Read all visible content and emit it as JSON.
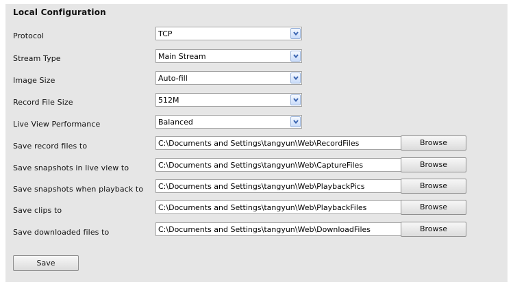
{
  "page": {
    "title": "Local Configuration"
  },
  "selects": [
    {
      "label": "Protocol",
      "value": "TCP"
    },
    {
      "label": "Stream Type",
      "value": "Main Stream"
    },
    {
      "label": "Image Size",
      "value": "Auto-fill"
    },
    {
      "label": "Record File Size",
      "value": "512M"
    },
    {
      "label": "Live View Performance",
      "value": "Balanced"
    }
  ],
  "paths": [
    {
      "label": "Save record files to",
      "value": "C:\\Documents and Settings\\tangyun\\Web\\RecordFiles"
    },
    {
      "label": "Save snapshots in live view to",
      "value": "C:\\Documents and Settings\\tangyun\\Web\\CaptureFiles"
    },
    {
      "label": "Save snapshots when playback to",
      "value": "C:\\Documents and Settings\\tangyun\\Web\\PlaybackPics"
    },
    {
      "label": "Save clips to",
      "value": "C:\\Documents and Settings\\tangyun\\Web\\PlaybackFiles"
    },
    {
      "label": "Save downloaded files to",
      "value": "C:\\Documents and Settings\\tangyun\\Web\\DownloadFiles"
    }
  ],
  "buttons": {
    "browse_label": "Browse",
    "save_label": "Save"
  },
  "icons": {
    "dropdown": "chevron-down-icon"
  },
  "colors": {
    "panel_background": "#e6e6e6",
    "dropdown_arrow": "#3a64b0"
  }
}
